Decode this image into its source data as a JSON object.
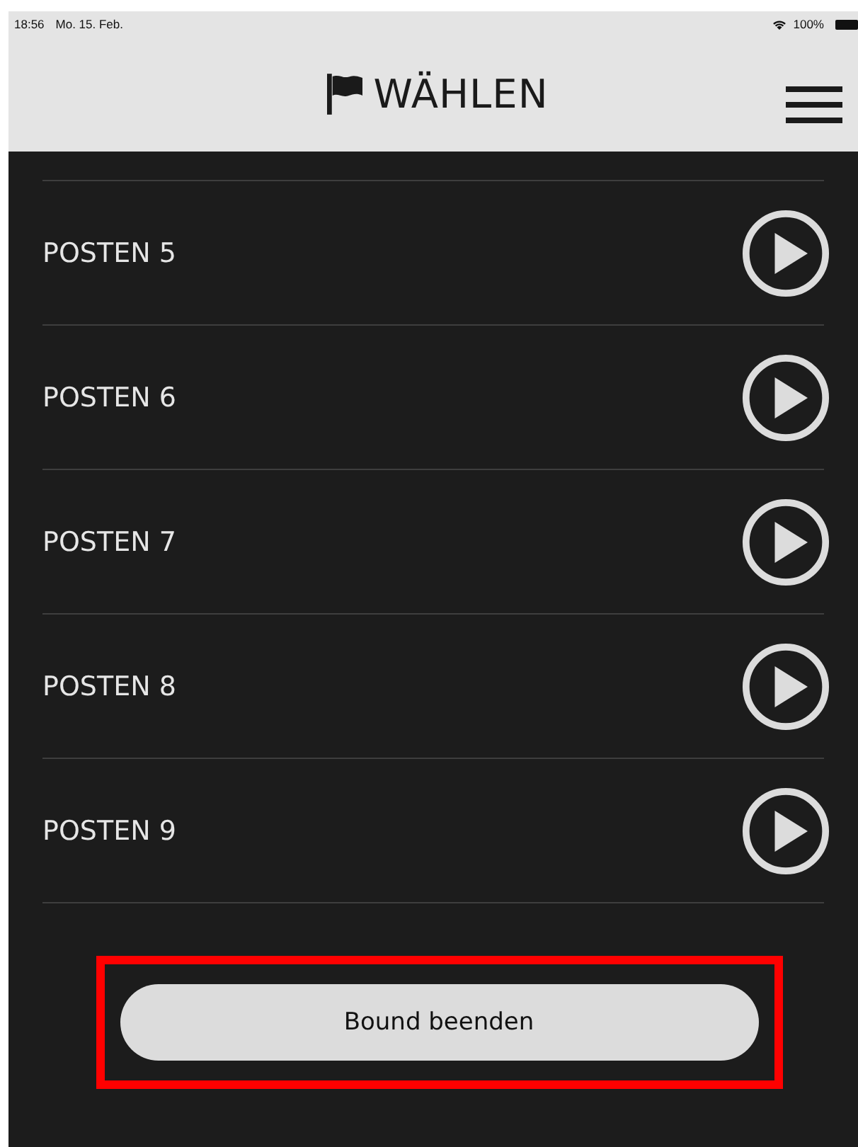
{
  "status_bar": {
    "time": "18:56",
    "date": "Mo. 15. Feb.",
    "battery": "100%"
  },
  "header": {
    "title": "WÄHLEN"
  },
  "posts": [
    {
      "label": "POSTEN 5"
    },
    {
      "label": "POSTEN 6"
    },
    {
      "label": "POSTEN 7"
    },
    {
      "label": "POSTEN 8"
    },
    {
      "label": "POSTEN 9"
    }
  ],
  "end_button": {
    "label": "Bound beenden",
    "highlighted": true
  }
}
